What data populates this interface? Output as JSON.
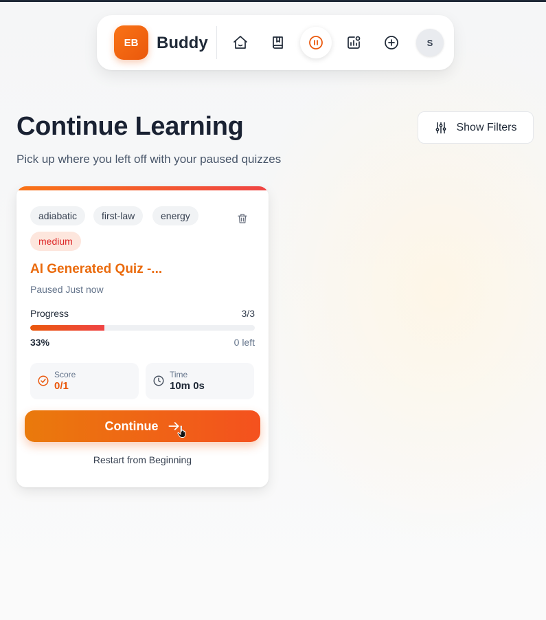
{
  "nav": {
    "logo_text": "EB",
    "brand": "Buddy",
    "icons": [
      "home-icon",
      "book-icon",
      "pause-icon",
      "stats-icon",
      "add-icon"
    ],
    "active_icon": "pause-icon",
    "avatar_initial": "S"
  },
  "header": {
    "title": "Continue Learning",
    "subtitle": "Pick up where you left off with your paused quizzes",
    "filters_label": "Show Filters"
  },
  "quiz_card": {
    "tags": [
      "adiabatic",
      "first-law",
      "energy"
    ],
    "difficulty": "medium",
    "title": "AI Generated Quiz -...",
    "paused_text": "Paused Just now",
    "progress_label": "Progress",
    "progress_count": "3/3",
    "progress_fraction": 0.33,
    "percent_text": "33%",
    "left_text": "0 left",
    "score_label": "Score",
    "score_value": "0/1",
    "time_label": "Time",
    "time_value": "10m 0s",
    "continue_label": "Continue",
    "restart_label": "Restart from Beginning"
  },
  "colors": {
    "accent": "#ea580c",
    "accent_red": "#ef4444",
    "title_orange": "#ea6a0c",
    "difficulty_bg": "#fde6dd"
  }
}
